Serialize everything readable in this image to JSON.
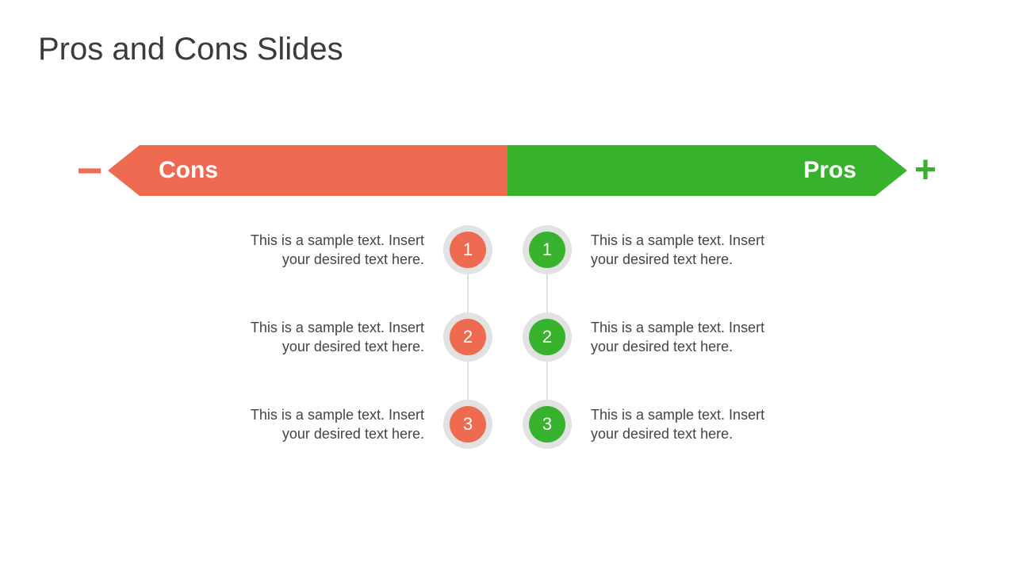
{
  "title": "Pros and Cons Slides",
  "cons_label": "Cons",
  "pros_label": "Pros",
  "colors": {
    "cons": "#ee6b52",
    "pros": "#36b22c",
    "ring": "#e2e2e2"
  },
  "cons": [
    {
      "num": "1",
      "text": "This is a sample text. Insert your desired text here."
    },
    {
      "num": "2",
      "text": "This is a sample text. Insert your desired text here."
    },
    {
      "num": "3",
      "text": "This is a sample text. Insert your desired text here."
    }
  ],
  "pros": [
    {
      "num": "1",
      "text": "This is a sample text. Insert your desired text here."
    },
    {
      "num": "2",
      "text": "This is a sample text. Insert your desired text here."
    },
    {
      "num": "3",
      "text": "This is a sample text. Insert your desired text here."
    }
  ]
}
